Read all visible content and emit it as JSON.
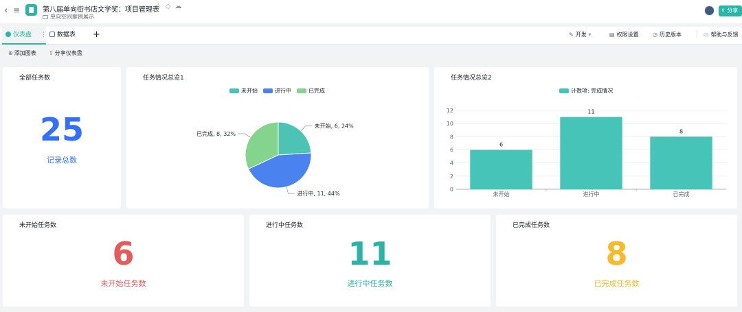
{
  "topbar": {
    "doc_title": "第八届单向街书店文学奖：项目管理表",
    "doc_path": "单向空间案例展示",
    "share_label": "分享"
  },
  "tabs": [
    {
      "label": "仪表盘"
    },
    {
      "label": "数据表"
    }
  ],
  "add_tab": "+",
  "toolbar": {
    "dev_label": "开发",
    "permissions_label": "权限设置",
    "history_label": "历史版本",
    "help_label": "帮助与反馈"
  },
  "actions": {
    "add_chart": "添加图表",
    "share_dashboard": "分享仪表盘"
  },
  "cards": {
    "total": {
      "title": "全部任务数",
      "value": "25",
      "label": "记录总数",
      "color": "#3370ff"
    },
    "not_started": {
      "title": "未开始任务数",
      "value": "6",
      "label": "未开始任务数",
      "color": "#e35b5b"
    },
    "in_progress": {
      "title": "进行中任务数",
      "value": "11",
      "label": "进行中任务数",
      "color": "#2ab3a6"
    },
    "done": {
      "title": "已完成任务数",
      "value": "8",
      "label": "已完成任务数",
      "color": "#f7ba2a"
    }
  },
  "chart_data": [
    {
      "type": "pie",
      "title": "任务情况总览1",
      "legend_position": "top",
      "categories": [
        "未开始",
        "进行中",
        "已完成"
      ],
      "values": [
        6,
        11,
        8
      ],
      "colors": [
        "#4cc3b5",
        "#4a83f0",
        "#84d48e"
      ],
      "data_labels": [
        "未开始, 6, 24%",
        "进行中, 11, 44%",
        "已完成, 8, 32%"
      ]
    },
    {
      "type": "bar",
      "title": "任务情况总览2",
      "legend_position": "top",
      "categories": [
        "未开始",
        "进行中",
        "已完成"
      ],
      "series": [
        {
          "name": "计数项: 完成情况",
          "values": [
            6,
            11,
            8
          ]
        }
      ],
      "color": "#47c4b8",
      "ylim": [
        0,
        12
      ],
      "yticks": [
        0,
        2,
        4,
        6,
        8,
        10,
        12
      ],
      "grid": true
    }
  ]
}
